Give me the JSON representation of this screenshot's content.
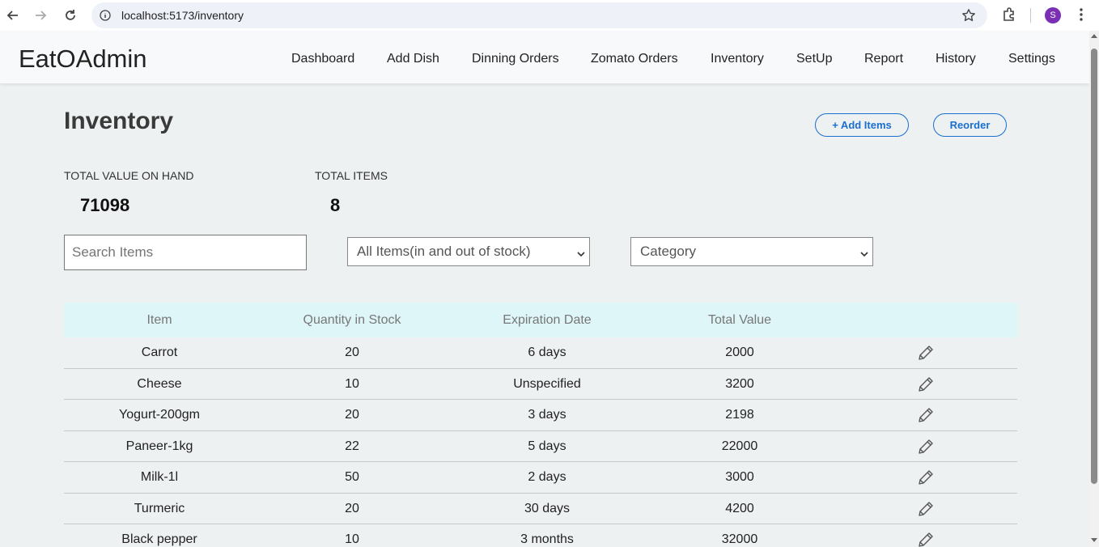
{
  "browser": {
    "url": "localhost:5173/inventory",
    "profile_initial": "S"
  },
  "header": {
    "brand": "EatOAdmin",
    "nav": [
      "Dashboard",
      "Add Dish",
      "Dinning Orders",
      "Zomato Orders",
      "Inventory",
      "SetUp",
      "Report",
      "History",
      "Settings"
    ]
  },
  "page": {
    "title": "Inventory",
    "add_button": "+ Add Items",
    "reorder_button": "Reorder"
  },
  "stats": {
    "total_value_label": "TOTAL VALUE ON HAND",
    "total_value": "71098",
    "total_items_label": "TOTAL ITEMS",
    "total_items": "8"
  },
  "filters": {
    "search_placeholder": "Search Items",
    "stock_filter": "All Items(in and out of stock)",
    "category_filter": "Category"
  },
  "table": {
    "headers": [
      "Item",
      "Quantity in Stock",
      "Expiration Date",
      "Total Value"
    ],
    "rows": [
      [
        "Carrot",
        "20",
        "6 days",
        "2000"
      ],
      [
        "Cheese",
        "10",
        "Unspecified",
        "3200"
      ],
      [
        "Yogurt-200gm",
        "20",
        "3 days",
        "2198"
      ],
      [
        "Paneer-1kg",
        "22",
        "5 days",
        "22000"
      ],
      [
        "Milk-1l",
        "50",
        "2 days",
        "3000"
      ],
      [
        "Turmeric",
        "20",
        "30 days",
        "4200"
      ],
      [
        "Black pepper",
        "10",
        "3 months",
        "32000"
      ]
    ]
  },
  "colors": {
    "accent": "#1a6fd0",
    "table_header_bg": "#def6f8",
    "page_bg": "#eef1f2"
  }
}
